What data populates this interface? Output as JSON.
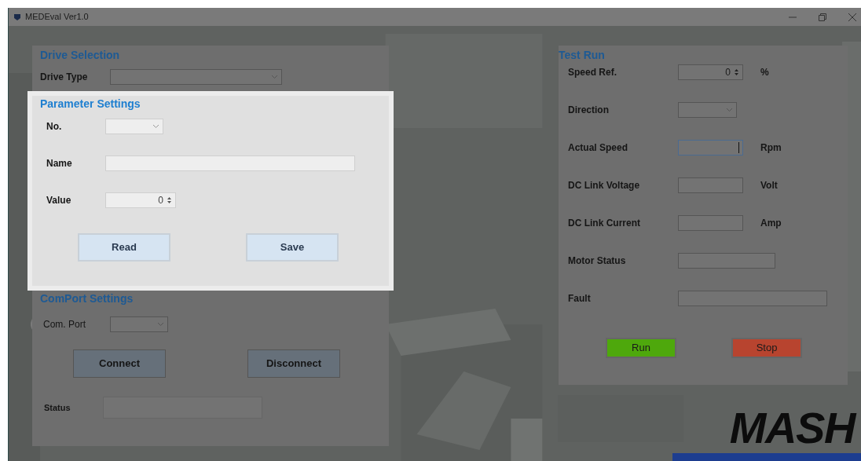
{
  "window": {
    "title": "MEDEval Ver1.0"
  },
  "drive_selection": {
    "title": "Drive Selection",
    "fields": [
      {
        "label": "Drive Type",
        "kind": "dropdown"
      }
    ]
  },
  "parameter_settings": {
    "title": "Parameter Settings",
    "fields": [
      {
        "label": "No.",
        "kind": "dropdown"
      },
      {
        "label": "Name",
        "kind": "text"
      },
      {
        "label": "Value",
        "kind": "spinner",
        "value": "0"
      }
    ],
    "buttons": [
      "Read",
      "Save"
    ]
  },
  "comport_settings": {
    "title": "ComPort Settings",
    "port_label": "Com. Port",
    "buttons": [
      "Connect",
      "Disconnect"
    ],
    "status_label": "Status"
  },
  "test_run": {
    "title": "Test Run",
    "rows": [
      {
        "label": "Speed Ref.",
        "kind": "spinner",
        "value": "0",
        "unit": "%",
        "focused": false
      },
      {
        "label": "Direction",
        "kind": "dropdown",
        "focused": false
      },
      {
        "label": "Actual Speed",
        "kind": "text",
        "unit": "Rpm",
        "focused": true
      },
      {
        "label": "DC Link Voltage",
        "kind": "text",
        "unit": "Volt",
        "focused": false
      },
      {
        "label": "DC Link Current",
        "kind": "text",
        "unit": "Amp",
        "focused": false
      },
      {
        "label": "Motor Status",
        "kind": "text",
        "focused": false
      },
      {
        "label": "Fault",
        "kind": "text",
        "focused": false
      }
    ],
    "buttons": [
      {
        "label": "Run",
        "color": "#4ea80c"
      },
      {
        "label": "Stop",
        "color": "#b8442f"
      }
    ]
  },
  "logo": {
    "text": "MASH"
  }
}
